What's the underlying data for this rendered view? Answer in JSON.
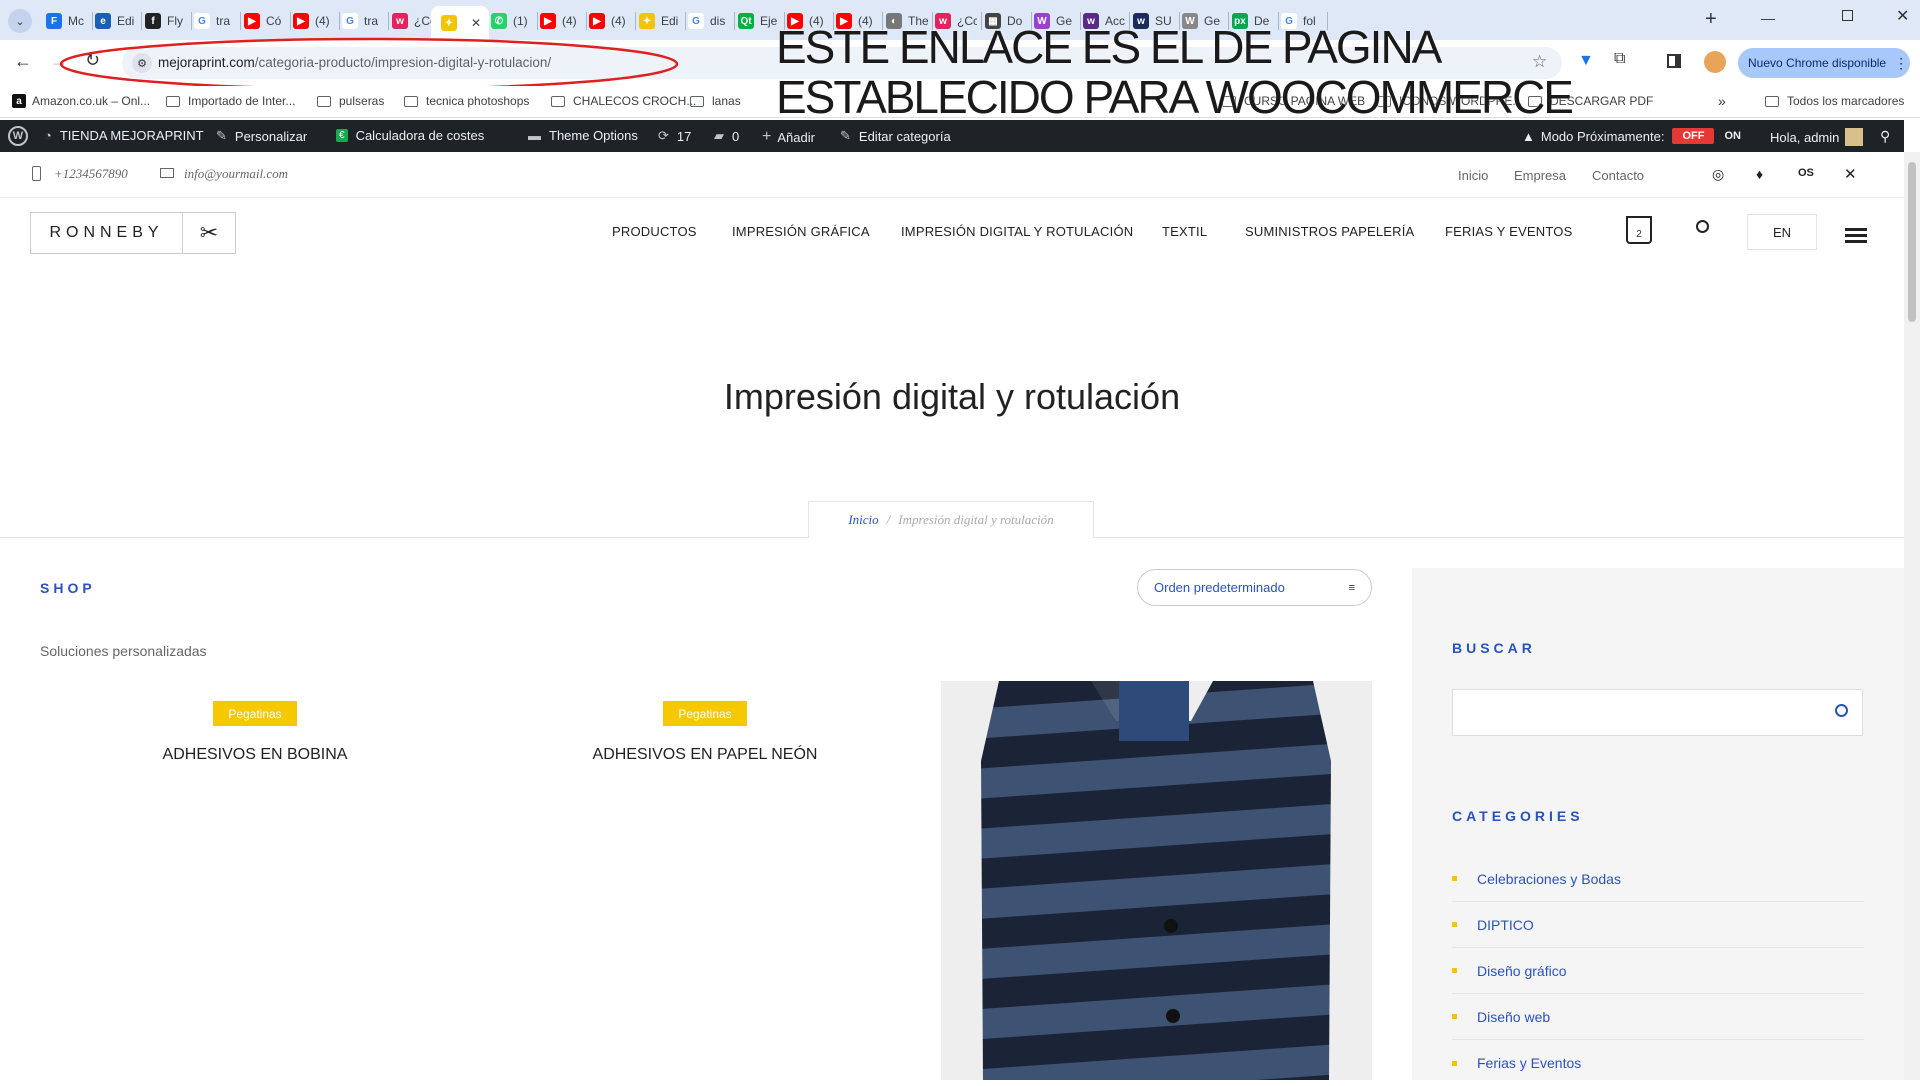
{
  "browser": {
    "tabs": [
      {
        "label": "Mc",
        "color": "#1a73e8",
        "glyph": "F"
      },
      {
        "label": "Edi",
        "color": "#1a5fb4",
        "glyph": "e"
      },
      {
        "label": "Fly",
        "color": "#222222",
        "glyph": "f"
      },
      {
        "label": "tra",
        "color": "#ffffff",
        "glyph": "G"
      },
      {
        "label": "Có",
        "color": "#ff0000",
        "glyph": "▶"
      },
      {
        "label": "(4)",
        "color": "#ff0000",
        "glyph": "▶"
      },
      {
        "label": "tra",
        "color": "#ffffff",
        "glyph": "G"
      },
      {
        "label": "¿Cc",
        "color": "#e0245e",
        "glyph": "w"
      },
      {
        "label": "",
        "color": "#f2c500",
        "glyph": "✦"
      },
      {
        "label": "(1)",
        "color": "#25d366",
        "glyph": "✆"
      },
      {
        "label": "(4)",
        "color": "#ff0000",
        "glyph": "▶"
      },
      {
        "label": "(4)",
        "color": "#ff0000",
        "glyph": "▶"
      },
      {
        "label": "Edi",
        "color": "#f2c500",
        "glyph": "✦"
      },
      {
        "label": "dis",
        "color": "#ffffff",
        "glyph": "G"
      },
      {
        "label": "Eje",
        "color": "#00b140",
        "glyph": "Qt"
      },
      {
        "label": "(4)",
        "color": "#ff0000",
        "glyph": "▶"
      },
      {
        "label": "(4)",
        "color": "#ff0000",
        "glyph": "▶"
      },
      {
        "label": "The",
        "color": "#777777",
        "glyph": "◐"
      },
      {
        "label": "¿Cc",
        "color": "#e0245e",
        "glyph": "w"
      },
      {
        "label": "Do",
        "color": "#444444",
        "glyph": "▦"
      },
      {
        "label": "Ge",
        "color": "#9b3fcf",
        "glyph": "W"
      },
      {
        "label": "Acc",
        "color": "#5b2a86",
        "glyph": "w"
      },
      {
        "label": "SU",
        "color": "#1d2b5a",
        "glyph": "w"
      },
      {
        "label": "Ge",
        "color": "#888888",
        "glyph": "W"
      },
      {
        "label": "De",
        "color": "#00a651",
        "glyph": "px"
      },
      {
        "label": "fol",
        "color": "#ffffff",
        "glyph": "G"
      }
    ],
    "url_host": "mejoraprint.com",
    "url_path": "/categoria-producto/impresion-digital-y-rotulacion/",
    "annotation": "ESTE ENLACE ES EL DE PAGINA ESTABLECIDO PARA WOOCOMMERCE",
    "annotation_color": "#e02020",
    "update_button": "Nuevo Chrome disponible",
    "bookmarks": [
      {
        "label": "Amazon.co.uk – Onl...",
        "kind": "site"
      },
      {
        "label": "Importado de Inter...",
        "kind": "folder"
      },
      {
        "label": "pulseras",
        "kind": "folder"
      },
      {
        "label": "tecnica photoshops",
        "kind": "folder"
      },
      {
        "label": "CHALECOS CROCH...",
        "kind": "folder"
      },
      {
        "label": "lanas",
        "kind": "folder"
      },
      {
        "label": "CURSO PAGINA WEB",
        "kind": "folder"
      },
      {
        "label": "ICONOS WORDPRE...",
        "kind": "folder"
      },
      {
        "label": "DESCARGAR PDF",
        "kind": "folder"
      }
    ],
    "all_bookmarks": "Todos los marcadores"
  },
  "admin_bar": {
    "site": "TIENDA MEJORAPRINT",
    "customize": "Personalizar",
    "calc": "Calculadora de costes",
    "theme": "Theme Options",
    "updates": "17",
    "comments": "0",
    "add": "Añadir",
    "edit": "Editar categoría",
    "mode_label": "Modo Próximamente:",
    "off": "OFF",
    "on": "ON",
    "greeting": "Hola, admin"
  },
  "site": {
    "phone": "+1234567890",
    "email": "info@yourmail.com",
    "top_links": [
      "Inicio",
      "Empresa",
      "Contacto"
    ],
    "logo_text": "RONNEBY",
    "nav": [
      "PRODUCTOS",
      "IMPRESIÓN GRÁFICA",
      "IMPRESIÓN DIGITAL Y ROTULACIÓN",
      "TEXTIL",
      "SUMINISTROS PAPELERÍA",
      "FERIAS Y EVENTOS"
    ],
    "cart_count": "2",
    "lang": "EN",
    "page_title": "Impresión digital y rotulación",
    "breadcrumb_home": "Inicio",
    "breadcrumb_sep": "/",
    "breadcrumb_current": "Impresión digital y rotulación",
    "shop_heading": "SHOP",
    "sort_label": "Orden predeterminado",
    "intro": "Soluciones personalizadas",
    "products": [
      {
        "badge": "Pegatinas",
        "title": "ADHESIVOS EN BOBINA"
      },
      {
        "badge": "Pegatinas",
        "title": "ADHESIVOS EN PAPEL NEÓN"
      }
    ],
    "sidebar": {
      "search_heading": "BUSCAR",
      "categories_heading": "CATEGORIES",
      "categories": [
        "Celebraciones y Bodas",
        "DIPTICO",
        "Diseño gráfico",
        "Diseño web",
        "Ferias y Eventos"
      ]
    }
  }
}
